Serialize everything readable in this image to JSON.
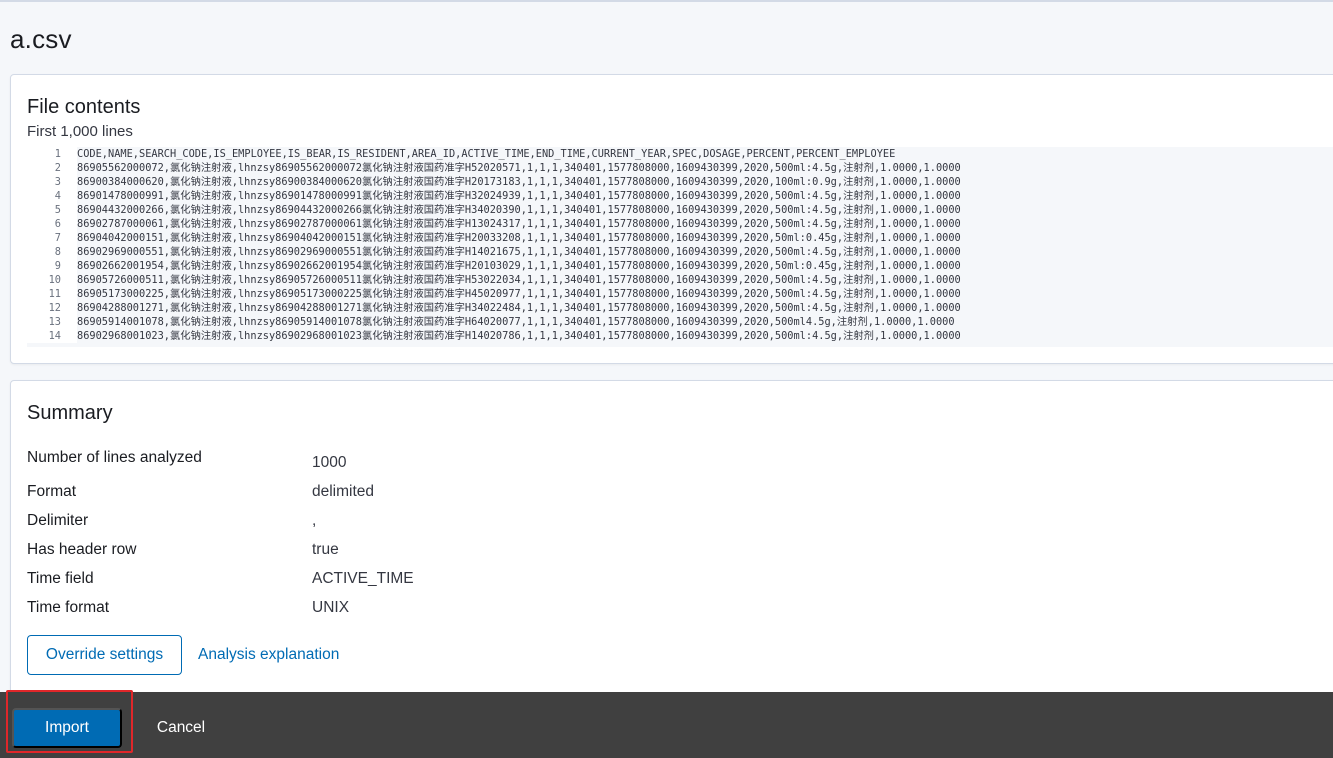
{
  "page": {
    "title": "a.csv"
  },
  "file_contents": {
    "title": "File contents",
    "subtitle": "First 1,000 lines",
    "lines": [
      {
        "n": "1",
        "text": "CODE,NAME,SEARCH_CODE,IS_EMPLOYEE,IS_BEAR,IS_RESIDENT,AREA_ID,ACTIVE_TIME,END_TIME,CURRENT_YEAR,SPEC,DOSAGE,PERCENT,PERCENT_EMPLOYEE"
      },
      {
        "n": "2",
        "text": "86905562000072,氯化钠注射液,lhnzsy86905562000072氯化钠注射液国药准字H52020571,1,1,1,340401,1577808000,1609430399,2020,500ml:4.5g,注射剂,1.0000,1.0000"
      },
      {
        "n": "3",
        "text": "86900384000620,氯化钠注射液,lhnzsy86900384000620氯化钠注射液国药准字H20173183,1,1,1,340401,1577808000,1609430399,2020,100ml:0.9g,注射剂,1.0000,1.0000"
      },
      {
        "n": "4",
        "text": "86901478000991,氯化钠注射液,lhnzsy86901478000991氯化钠注射液国药准字H32024939,1,1,1,340401,1577808000,1609430399,2020,500ml:4.5g,注射剂,1.0000,1.0000"
      },
      {
        "n": "5",
        "text": "86904432000266,氯化钠注射液,lhnzsy86904432000266氯化钠注射液国药准字H34020390,1,1,1,340401,1577808000,1609430399,2020,500ml:4.5g,注射剂,1.0000,1.0000"
      },
      {
        "n": "6",
        "text": "86902787000061,氯化钠注射液,lhnzsy86902787000061氯化钠注射液国药准字H13024317,1,1,1,340401,1577808000,1609430399,2020,500ml:4.5g,注射剂,1.0000,1.0000"
      },
      {
        "n": "7",
        "text": "86904042000151,氯化钠注射液,lhnzsy86904042000151氯化钠注射液国药准字H20033208,1,1,1,340401,1577808000,1609430399,2020,50ml:0.45g,注射剂,1.0000,1.0000"
      },
      {
        "n": "8",
        "text": "86902969000551,氯化钠注射液,lhnzsy86902969000551氯化钠注射液国药准字H14021675,1,1,1,340401,1577808000,1609430399,2020,500ml:4.5g,注射剂,1.0000,1.0000"
      },
      {
        "n": "9",
        "text": "86902662001954,氯化钠注射液,lhnzsy86902662001954氯化钠注射液国药准字H20103029,1,1,1,340401,1577808000,1609430399,2020,50ml:0.45g,注射剂,1.0000,1.0000"
      },
      {
        "n": "10",
        "text": "86905726000511,氯化钠注射液,lhnzsy86905726000511氯化钠注射液国药准字H53022034,1,1,1,340401,1577808000,1609430399,2020,500ml:4.5g,注射剂,1.0000,1.0000"
      },
      {
        "n": "11",
        "text": "86905173000225,氯化钠注射液,lhnzsy86905173000225氯化钠注射液国药准字H45020977,1,1,1,340401,1577808000,1609430399,2020,500ml:4.5g,注射剂,1.0000,1.0000"
      },
      {
        "n": "12",
        "text": "86904288001271,氯化钠注射液,lhnzsy86904288001271氯化钠注射液国药准字H34022484,1,1,1,340401,1577808000,1609430399,2020,500ml:4.5g,注射剂,1.0000,1.0000"
      },
      {
        "n": "13",
        "text": "86905914001078,氯化钠注射液,lhnzsy86905914001078氯化钠注射液国药准字H64020077,1,1,1,340401,1577808000,1609430399,2020,500ml4.5g,注射剂,1.0000,1.0000"
      },
      {
        "n": "14",
        "text": "86902968001023,氯化钠注射液,lhnzsy86902968001023氯化钠注射液国药准字H14020786,1,1,1,340401,1577808000,1609430399,2020,500ml:4.5g,注射剂,1.0000,1.0000"
      }
    ]
  },
  "summary": {
    "title": "Summary",
    "rows": [
      {
        "key": "Number of lines analyzed",
        "value": "1000"
      },
      {
        "key": "Format",
        "value": "delimited"
      },
      {
        "key": "Delimiter",
        "value": ","
      },
      {
        "key": "Has header row",
        "value": "true"
      },
      {
        "key": "Time field",
        "value": "ACTIVE_TIME"
      },
      {
        "key": "Time format",
        "value": "UNIX"
      }
    ],
    "override_label": "Override settings",
    "explanation_label": "Analysis explanation"
  },
  "footer": {
    "import_label": "Import",
    "cancel_label": "Cancel"
  },
  "colors": {
    "primary": "#006bb4",
    "bottom_bar": "#404040",
    "highlight": "#e0272a"
  }
}
